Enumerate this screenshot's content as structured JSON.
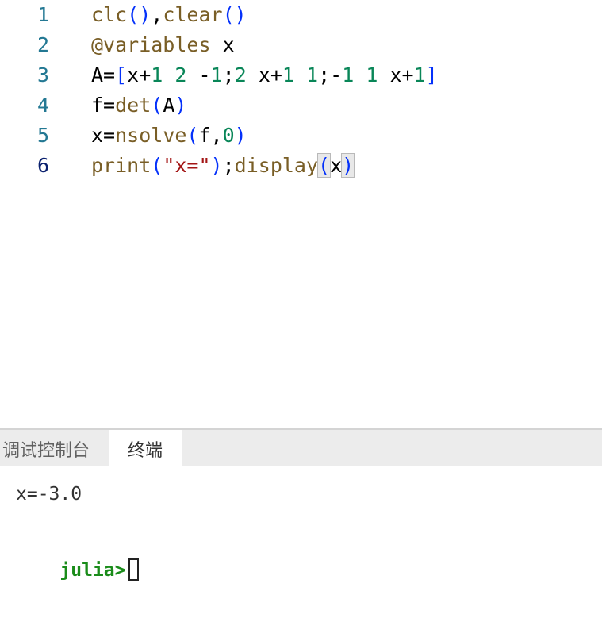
{
  "editor": {
    "line_numbers": [
      "1",
      "2",
      "3",
      "4",
      "5",
      "6"
    ],
    "lines": [
      [
        {
          "t": "clc",
          "c": "fn"
        },
        {
          "t": "()",
          "c": "br"
        },
        {
          "t": ",",
          "c": "plain"
        },
        {
          "t": "clear",
          "c": "fn"
        },
        {
          "t": "()",
          "c": "br"
        }
      ],
      [
        {
          "t": "@variables",
          "c": "fn"
        },
        {
          "t": " x",
          "c": "plain"
        }
      ],
      [
        {
          "t": "A=",
          "c": "plain"
        },
        {
          "t": "[",
          "c": "br"
        },
        {
          "t": "x+",
          "c": "plain"
        },
        {
          "t": "1",
          "c": "num"
        },
        {
          "t": " ",
          "c": "plain"
        },
        {
          "t": "2",
          "c": "num"
        },
        {
          "t": " -",
          "c": "plain"
        },
        {
          "t": "1",
          "c": "num"
        },
        {
          "t": ";",
          "c": "plain"
        },
        {
          "t": "2",
          "c": "num"
        },
        {
          "t": " x+",
          "c": "plain"
        },
        {
          "t": "1",
          "c": "num"
        },
        {
          "t": " ",
          "c": "plain"
        },
        {
          "t": "1",
          "c": "num"
        },
        {
          "t": ";-",
          "c": "plain"
        },
        {
          "t": "1",
          "c": "num"
        },
        {
          "t": " ",
          "c": "plain"
        },
        {
          "t": "1",
          "c": "num"
        },
        {
          "t": " x+",
          "c": "plain"
        },
        {
          "t": "1",
          "c": "num"
        },
        {
          "t": "]",
          "c": "br"
        }
      ],
      [
        {
          "t": "f=",
          "c": "plain"
        },
        {
          "t": "det",
          "c": "fn"
        },
        {
          "t": "(",
          "c": "br"
        },
        {
          "t": "A",
          "c": "plain"
        },
        {
          "t": ")",
          "c": "br"
        }
      ],
      [
        {
          "t": "x=",
          "c": "plain"
        },
        {
          "t": "nsolve",
          "c": "fn"
        },
        {
          "t": "(",
          "c": "br"
        },
        {
          "t": "f,",
          "c": "plain"
        },
        {
          "t": "0",
          "c": "num"
        },
        {
          "t": ")",
          "c": "br"
        }
      ],
      [
        {
          "t": "print",
          "c": "fn"
        },
        {
          "t": "(",
          "c": "br"
        },
        {
          "t": "\"x=\"",
          "c": "str"
        },
        {
          "t": ")",
          "c": "br"
        },
        {
          "t": ";",
          "c": "plain"
        },
        {
          "t": "display",
          "c": "fn"
        },
        {
          "t": "(",
          "c": "br match"
        },
        {
          "t": "x",
          "c": "plain"
        },
        {
          "t": ")",
          "c": "br match"
        }
      ]
    ]
  },
  "panel": {
    "tabs": [
      {
        "label": "调试控制台",
        "active": false
      },
      {
        "label": "终端",
        "active": true
      }
    ],
    "terminal": {
      "output": "x=-3.0",
      "prompt": "julia>"
    }
  },
  "colors": {
    "function": "#795e26",
    "bracket": "#0431fa",
    "number": "#098658",
    "string": "#a31515",
    "line_number": "#237893",
    "prompt": "#1a8c1a"
  }
}
